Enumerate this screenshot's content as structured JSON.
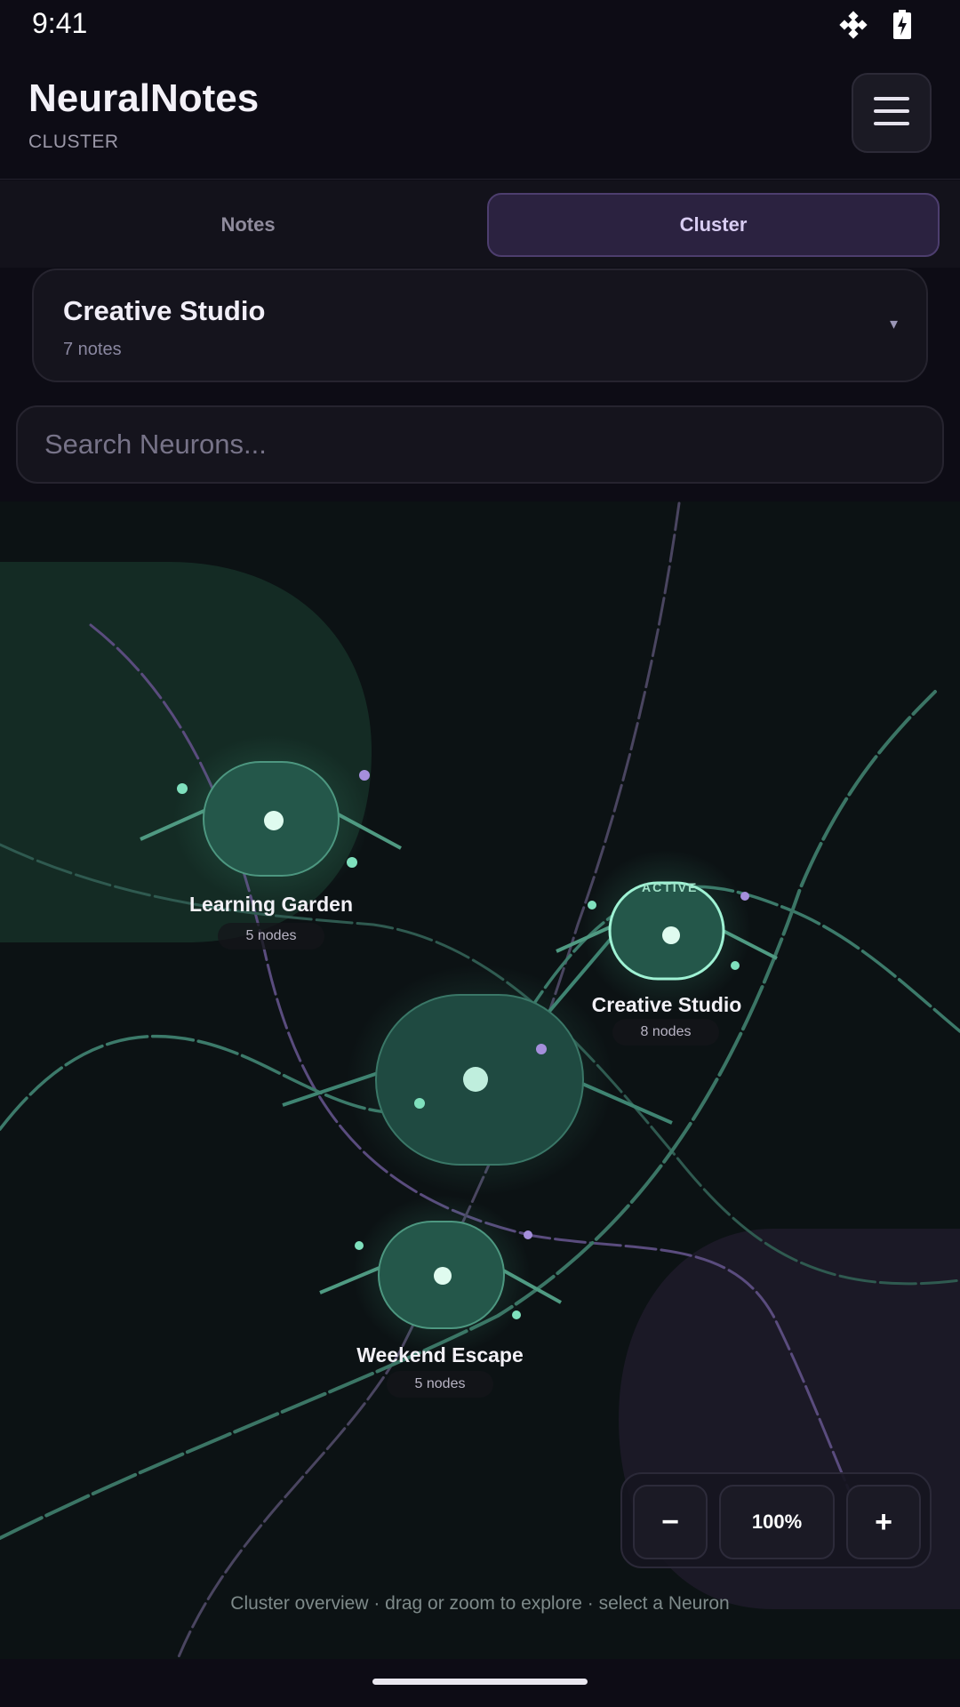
{
  "status": {
    "time": "9:41",
    "icons": [
      "satellite-icon",
      "battery-charging-icon"
    ]
  },
  "header": {
    "title": "NeuralNotes",
    "subtitle": "CLUSTER",
    "menu_icon": "hamburger-menu-icon"
  },
  "tabs": [
    {
      "label": "Notes",
      "active": false
    },
    {
      "label": "Cluster",
      "active": true
    }
  ],
  "cluster_select": {
    "title": "Creative Studio",
    "subtitle": "7 notes",
    "caret": "▾"
  },
  "search": {
    "placeholder": "Search Neurons..."
  },
  "map": {
    "neurons": [
      {
        "label": "Learning Garden",
        "count": "5 nodes"
      },
      {
        "label": "Creative Studio",
        "count": "8 nodes",
        "badge": "ACTIVE"
      },
      {
        "label": "Weekend Escape",
        "count": "5 nodes"
      }
    ],
    "zoom": {
      "minus": "−",
      "level": "100%",
      "plus": "+"
    },
    "hint": "Cluster overview · drag or zoom to explore · select a Neuron"
  },
  "colors": {
    "accent_green": "#8fe6c8",
    "accent_purple": "#b59ae6",
    "background": "#0d0c15",
    "map_background": "#0c1214"
  }
}
